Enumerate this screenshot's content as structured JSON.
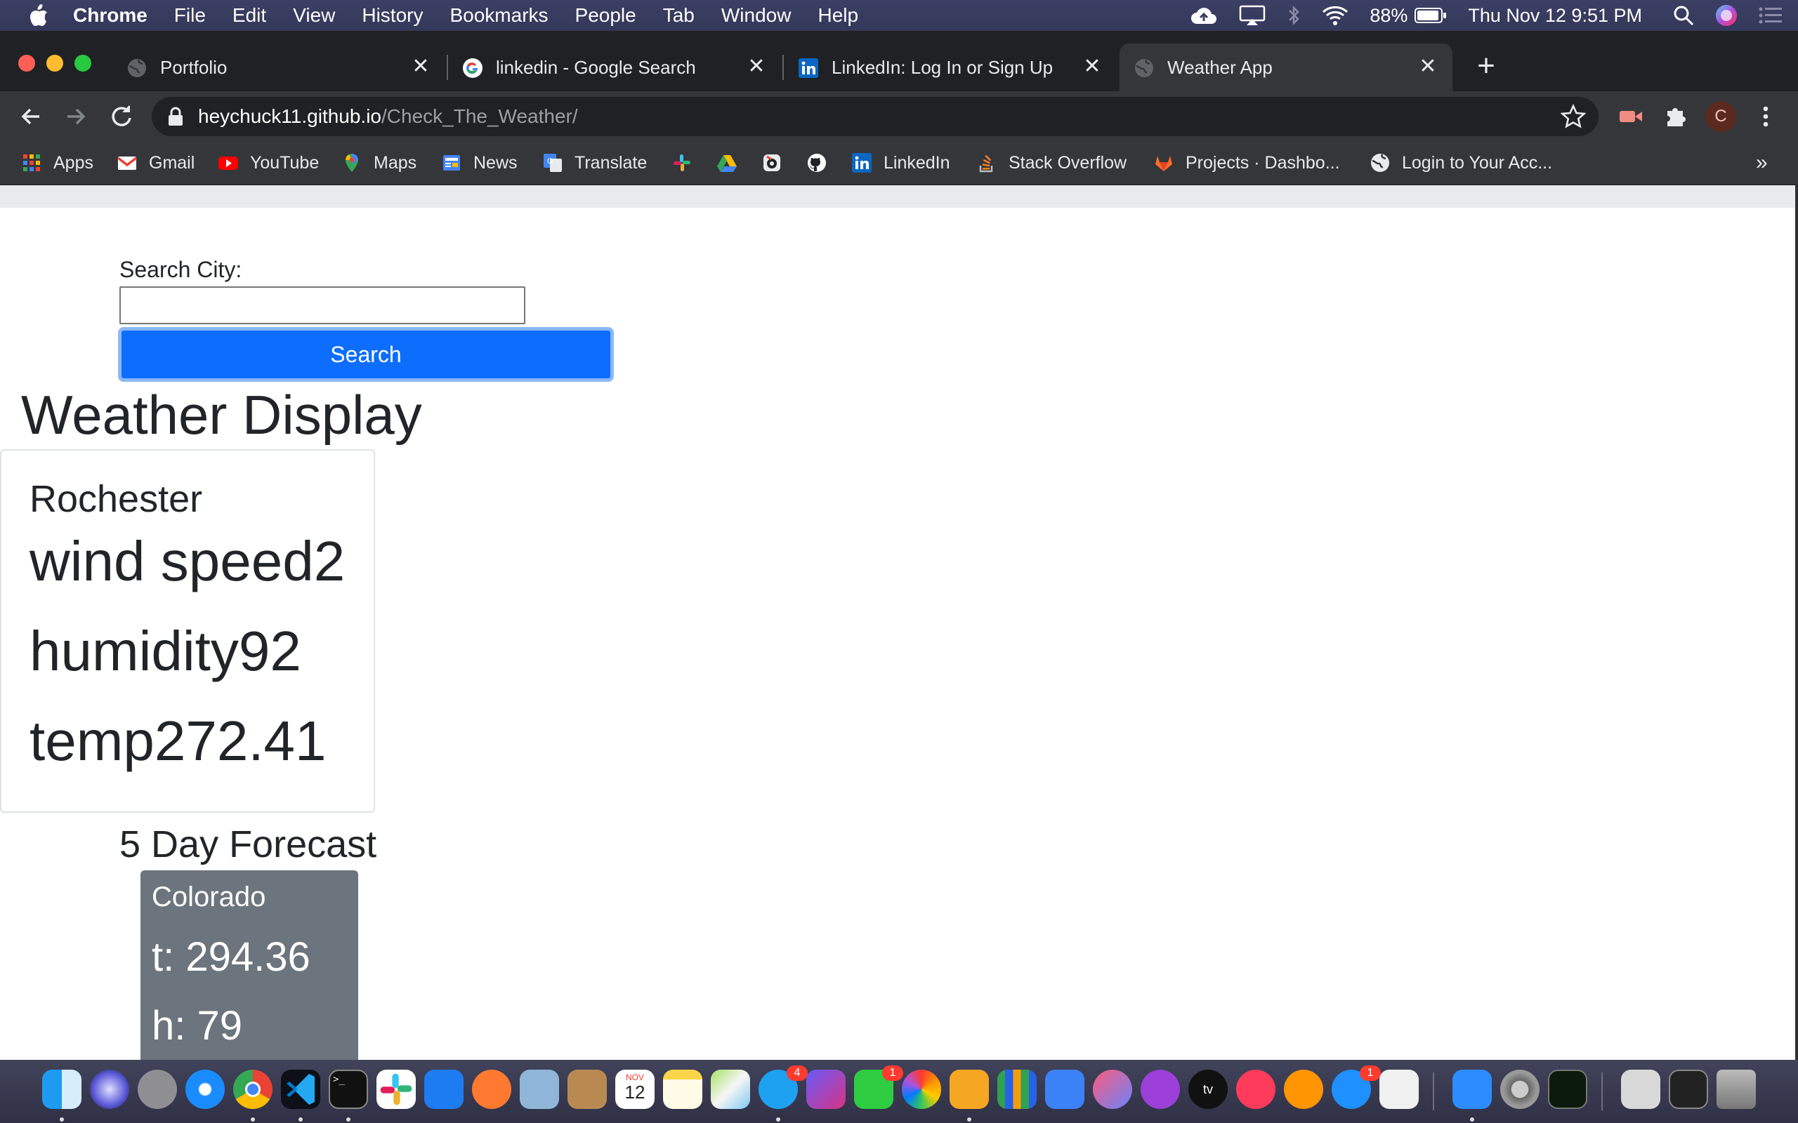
{
  "menubar": {
    "app_name": "Chrome",
    "menus": [
      "File",
      "Edit",
      "View",
      "History",
      "Bookmarks",
      "People",
      "Tab",
      "Window",
      "Help"
    ],
    "battery": "88%",
    "datetime": "Thu Nov 12  9:51 PM"
  },
  "tabs": [
    {
      "title": "Portfolio",
      "icon": "globe-icon",
      "active": false
    },
    {
      "title": "linkedin - Google Search",
      "icon": "google-icon",
      "active": false
    },
    {
      "title": "LinkedIn: Log In or Sign Up",
      "icon": "linkedin-icon",
      "active": false
    },
    {
      "title": "Weather App",
      "icon": "globe-icon",
      "active": true
    }
  ],
  "omnibox": {
    "host": "heychuck11.github.io",
    "path": "/Check_The_Weather/"
  },
  "profile_initial": "C",
  "bookmarks": [
    {
      "label": "Apps",
      "icon": "apps-grid-icon"
    },
    {
      "label": "Gmail",
      "icon": "gmail-icon"
    },
    {
      "label": "YouTube",
      "icon": "youtube-icon"
    },
    {
      "label": "Maps",
      "icon": "maps-icon"
    },
    {
      "label": "News",
      "icon": "news-icon"
    },
    {
      "label": "Translate",
      "icon": "translate-icon"
    },
    {
      "label": "",
      "icon": "slack-icon"
    },
    {
      "label": "",
      "icon": "drive-icon"
    },
    {
      "label": "",
      "icon": "camera-icon"
    },
    {
      "label": "",
      "icon": "github-icon"
    },
    {
      "label": "LinkedIn",
      "icon": "linkedin-icon"
    },
    {
      "label": "Stack Overflow",
      "icon": "stackoverflow-icon"
    },
    {
      "label": "Projects · Dashbo...",
      "icon": "gitlab-icon"
    },
    {
      "label": "Login to Your Acc...",
      "icon": "globe-icon"
    }
  ],
  "bookmarks_overflow": "»",
  "page": {
    "search_label": "Search City:",
    "search_value": "",
    "search_button": "Search",
    "title": "Weather Display",
    "current": {
      "city": "Rochester",
      "wind": "wind speed2",
      "humidity": "humidity92",
      "temp": "temp272.41"
    },
    "forecast_title": "5 Day Forecast",
    "forecast": [
      {
        "city": "Colorado",
        "temp": "t: 294.36",
        "humidity": "h: 79"
      }
    ]
  },
  "dock": {
    "badges": {
      "messages": "4",
      "facetime": "1",
      "appstore": "1"
    },
    "calendar_month": "NOV",
    "calendar_day": "12"
  },
  "colors": {
    "primary_button": "#0d6efd",
    "forecast_card": "#6c757d",
    "chrome_dark": "#35363a"
  }
}
